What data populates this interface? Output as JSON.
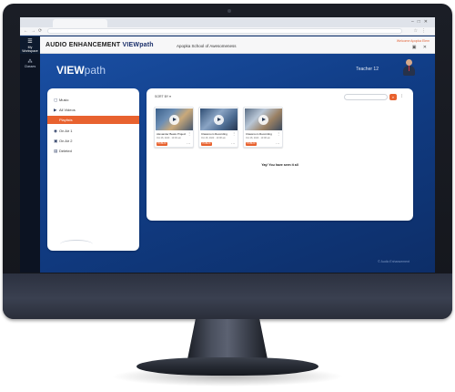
{
  "browser": {
    "tab_title": "",
    "nav_glyphs": "←→⟳",
    "window_controls": "–□✕",
    "toolbar_icons": "☆⋮"
  },
  "app": {
    "menu_label": "My Workspace",
    "logo_main": "AUDIO ENHANCEMENT",
    "logo_vp": "VIEWpath",
    "school_name": "Apopka School of Awesomeness",
    "header_link": "Welcome Apopka Elem",
    "header_icons": "▣ ✕"
  },
  "rail": {
    "item_label": "Classes"
  },
  "main": {
    "brand_bold": "VIEW",
    "brand_light": "path",
    "teacher_name": "Teacher 12",
    "footer_mark": "© Audio Enhancement"
  },
  "sidebar": {
    "items": [
      {
        "icon": "▢",
        "label": "Music"
      },
      {
        "icon": "▶",
        "label": "All Videos"
      },
      {
        "icon": "",
        "label": "Playlists"
      },
      {
        "icon": "◉",
        "label": "On Air 1"
      },
      {
        "icon": "▣",
        "label": "On Air 2"
      },
      {
        "icon": "▤",
        "label": "Deleted"
      }
    ]
  },
  "content": {
    "sort_label": "SORT BY ▾",
    "search_icon": "⌕",
    "grid_icon": "⁞",
    "videos": [
      {
        "title": "Alexander Beats Project",
        "meta": "Oct 28, 2020 · 10:00 am",
        "badge": "PUBLIC",
        "more": "⋮",
        "menu": "⋯"
      },
      {
        "title": "Classroom Recording",
        "meta": "Oct 28, 2020 · 10:08 am",
        "badge": "PUBLIC",
        "more": "⋮",
        "menu": "⋯"
      },
      {
        "title": "Classroom Recording",
        "meta": "Oct 28, 2020 · 10:08 am",
        "badge": "PUBLIC",
        "more": "⋮",
        "menu": "⋯"
      }
    ],
    "end_note": "Yay! You have seen it all"
  }
}
